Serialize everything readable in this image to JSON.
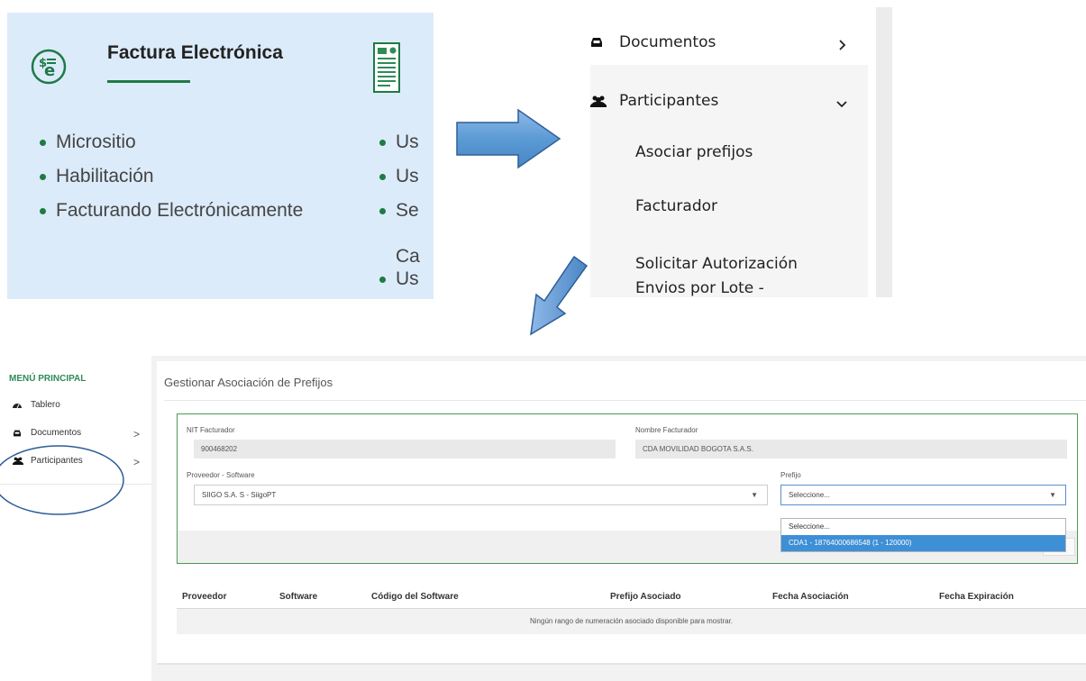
{
  "panel1": {
    "title": "Factura Electrónica",
    "list_left": [
      "Micrositio",
      "Habilitación",
      "Facturando Electrónicamente"
    ],
    "list_right": [
      "Us",
      "Us",
      "Se",
      "Us"
    ],
    "extra_text": "Ca",
    "accent_color": "#1f7a45",
    "background_color": "#dcebfa",
    "icons": [
      "factura-electronica-icon",
      "document-icon"
    ]
  },
  "panel2": {
    "documentos_label": "Documentos",
    "participantes_label": "Participantes",
    "sub_items": [
      "Asociar prefijos",
      "Facturador",
      "Solicitar Autorización Envios por Lote - Asíncrono"
    ],
    "icons": [
      "inbox-icon",
      "users-icon",
      "chevron-right-icon",
      "chevron-down-icon"
    ]
  },
  "arrows": {
    "fill_color": "#5b9bd5"
  },
  "panel3": {
    "sidebar": {
      "heading": "MENÚ PRINCIPAL",
      "items": [
        {
          "label": "Tablero",
          "icon": "dashboard-icon"
        },
        {
          "label": "Documentos",
          "icon": "inbox-icon",
          "chevron": ">"
        },
        {
          "label": "Participantes",
          "icon": "users-icon",
          "chevron": ">"
        }
      ]
    },
    "page_title": "Gestionar Asociación de Prefijos",
    "form": {
      "nit_label": "NIT Facturador",
      "nit_value": "900468202",
      "nombre_label": "Nombre Facturador",
      "nombre_value": "CDA MOVILIDAD BOGOTA S.A.S.",
      "proveedor_label": "Proveedor - Software",
      "proveedor_value": "SIIGO S.A. S - SiigoPT",
      "prefijo_label": "Prefijo",
      "prefijo_value": "Seleccione...",
      "prefijo_options": [
        "Seleccione...",
        "CDA1 - 18764000686548 (1 - 120000)"
      ],
      "highlight_color": "#3d8fd6",
      "border_color": "#4c9a57"
    },
    "table": {
      "headers": [
        "Proveedor",
        "Software",
        "Código del Software",
        "Prefijo Asociado",
        "Fecha Asociación",
        "Fecha Expiración"
      ],
      "empty_message": "Ningún rango de numeración asociado disponible para mostrar."
    }
  }
}
